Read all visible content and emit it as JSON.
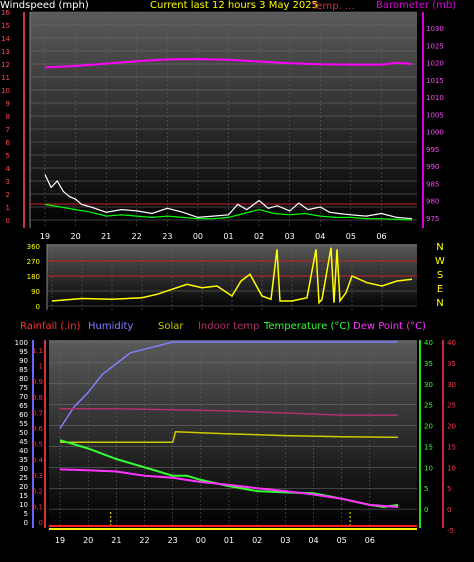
{
  "header": {
    "windspeed_label": "Windspeed (mph)",
    "title": "Current last 12 hours 3 May 2025",
    "temp_label": "Temp. ...",
    "barometer_label": "Barometer (mb)"
  },
  "wind_dir_labels": [
    "N",
    "W",
    "S",
    "E",
    "N"
  ],
  "bottom_header": {
    "rainfall": "Rainfall (.in)",
    "humidity": "Humidity",
    "solar": "Solar",
    "indoor_temp": "Indoor temp",
    "temperature": "Temperature (°C)",
    "dew_point": "Dew Point (°C)"
  },
  "hour_labels": [
    "19",
    "20",
    "21",
    "22",
    "23",
    "00",
    "01",
    "02",
    "03",
    "04",
    "05",
    "06"
  ],
  "colors": {
    "windspeed": "#ffffff",
    "wind_avg": "#00ff00",
    "barometer": "#ff00ff",
    "wind_direction": "#ffff00",
    "rainfall": "#ff3333",
    "humidity": "#8080ff",
    "solar": "#cccc00",
    "indoor_temp": "#b0306a",
    "temperature": "#33ff33",
    "dew_point": "#ff33ff",
    "left_axis_red": "#cc3344",
    "right_axis_magenta": "#dd00dd",
    "right_axis_green": "#22dd22",
    "right_axis_red": "#cc2244"
  },
  "chart_data": [
    {
      "id": "wind-barometer",
      "type": "line",
      "x_hours": [
        0,
        12
      ],
      "x_ticks": [
        "19",
        "20",
        "21",
        "22",
        "23",
        "00",
        "01",
        "02",
        "03",
        "04",
        "05",
        "06"
      ],
      "ylabel_left": "Windspeed (mph)",
      "ylabel_right": "Barometer (mb)",
      "ylim_left": [
        0,
        16
      ],
      "yticks_left": [
        0,
        1,
        2,
        3,
        4,
        5,
        6,
        7,
        8,
        9,
        10,
        11,
        12,
        13,
        14,
        15,
        16
      ],
      "ylim_right": [
        975,
        1030
      ],
      "yticks_right": [
        975,
        980,
        985,
        990,
        995,
        1000,
        1005,
        1010,
        1015,
        1020,
        1025,
        1030
      ],
      "series": [
        {
          "key": "barometer",
          "axis": "right",
          "x": [
            0,
            1,
            2,
            3,
            4,
            5,
            6,
            7,
            8,
            9,
            10,
            11,
            11.5,
            12
          ],
          "values": [
            1018.6,
            1019.0,
            1019.7,
            1020.4,
            1020.9,
            1021.0,
            1020.8,
            1020.3,
            1019.8,
            1019.5,
            1019.4,
            1019.4,
            1019.9,
            1019.6
          ]
        },
        {
          "key": "windspeed",
          "axis": "left",
          "x": [
            0,
            0.2,
            0.4,
            0.6,
            0.8,
            1.0,
            1.2,
            1.5,
            2.0,
            2.5,
            3.0,
            3.5,
            4.0,
            4.5,
            5.0,
            5.5,
            6.0,
            6.3,
            6.6,
            7.0,
            7.3,
            7.6,
            8.0,
            8.3,
            8.6,
            9.0,
            9.3,
            9.6,
            10.0,
            10.5,
            11.0,
            11.5,
            12.0
          ],
          "values": [
            3.5,
            2.5,
            3.0,
            2.2,
            1.8,
            1.6,
            1.2,
            1.0,
            0.6,
            0.8,
            0.7,
            0.5,
            0.9,
            0.6,
            0.2,
            0.3,
            0.4,
            1.2,
            0.8,
            1.5,
            0.9,
            1.1,
            0.7,
            1.3,
            0.8,
            1.0,
            0.6,
            0.5,
            0.4,
            0.3,
            0.5,
            0.2,
            0.1
          ]
        },
        {
          "key": "wind_avg",
          "axis": "left",
          "x": [
            0,
            0.5,
            1.0,
            1.5,
            2.0,
            2.5,
            3.0,
            3.5,
            4.0,
            4.5,
            5.0,
            5.5,
            6.0,
            6.5,
            7.0,
            7.5,
            8.0,
            8.5,
            9.0,
            9.5,
            10.0,
            10.5,
            11.0,
            12.0
          ],
          "values": [
            1.2,
            1.0,
            0.8,
            0.6,
            0.3,
            0.4,
            0.3,
            0.2,
            0.3,
            0.2,
            0.1,
            0.1,
            0.2,
            0.5,
            0.8,
            0.5,
            0.4,
            0.5,
            0.3,
            0.2,
            0.2,
            0.1,
            0.1,
            0.0
          ]
        }
      ]
    },
    {
      "id": "wind-direction",
      "type": "line",
      "x_hours": [
        0,
        12
      ],
      "ylim": [
        0,
        360
      ],
      "yticks": [
        0,
        90,
        180,
        270,
        360
      ],
      "ref_lines": [
        180,
        270
      ],
      "series": [
        {
          "key": "wind_direction",
          "x": [
            0,
            1,
            2,
            3,
            3.5,
            4,
            4.5,
            5,
            5.5,
            6,
            6.3,
            6.6,
            7,
            7.3,
            7.5,
            7.6,
            8,
            8.5,
            8.8,
            8.9,
            9.0,
            9.3,
            9.4,
            9.5,
            9.6,
            9.8,
            10,
            10.5,
            11,
            11.5,
            12
          ],
          "values": [
            30,
            45,
            40,
            50,
            70,
            100,
            130,
            110,
            120,
            60,
            150,
            190,
            60,
            40,
            340,
            30,
            30,
            50,
            340,
            20,
            40,
            350,
            20,
            340,
            30,
            80,
            180,
            140,
            120,
            150,
            160
          ]
        }
      ]
    },
    {
      "id": "temp-humidity",
      "type": "line",
      "x_hours": [
        0,
        12
      ],
      "axes": {
        "rainfall": {
          "ylim": [
            0,
            1.15
          ],
          "yticks": [
            0,
            0.1,
            0.2,
            0.3,
            0.4,
            0.5,
            0.6,
            0.7,
            0.8,
            0.9,
            1.0,
            1.1
          ]
        },
        "humidity": {
          "ylim": [
            0,
            100
          ],
          "yticks": [
            0,
            5,
            10,
            15,
            20,
            25,
            30,
            35,
            40,
            45,
            50,
            55,
            60,
            65,
            70,
            75,
            80,
            85,
            90,
            95,
            100
          ]
        },
        "temperature": {
          "ylim": [
            -5,
            40
          ],
          "yticks": [
            0,
            5,
            10,
            15,
            20,
            25,
            30,
            35,
            40
          ]
        },
        "indoor": {
          "ylim": [
            -5,
            40
          ],
          "yticks": [
            -5,
            0,
            5,
            10,
            15,
            20,
            25,
            30,
            35,
            40
          ]
        }
      },
      "series": [
        {
          "key": "humidity",
          "axis": "humidity",
          "x": [
            0,
            0.5,
            1,
            1.5,
            2,
            2.5,
            3,
            3.5,
            4,
            12
          ],
          "values": [
            52,
            64,
            72,
            82,
            88,
            94,
            96,
            98,
            100,
            100
          ]
        },
        {
          "key": "indoor_temp",
          "axis": "indoor",
          "x": [
            0,
            2,
            4,
            6,
            8,
            10,
            12
          ],
          "values": [
            24,
            24,
            23.8,
            23.5,
            23.0,
            22.5,
            22.5
          ]
        },
        {
          "key": "solar",
          "axis": "temperature",
          "x": [
            0,
            4,
            4.1,
            6,
            8,
            10,
            12
          ],
          "values": [
            16,
            16,
            18.5,
            18,
            17.6,
            17.3,
            17.2
          ]
        },
        {
          "key": "temperature",
          "axis": "temperature",
          "x": [
            0,
            1,
            2,
            3,
            4,
            4.5,
            5,
            6,
            7,
            8,
            9,
            10,
            11,
            11.5,
            12
          ],
          "values": [
            16.5,
            14.5,
            12,
            10,
            8,
            8,
            7,
            5.5,
            4.3,
            4.0,
            3.8,
            2.5,
            1.0,
            0.5,
            1.0
          ]
        },
        {
          "key": "dew_point",
          "axis": "temperature",
          "x": [
            0,
            1,
            2,
            3,
            4,
            5,
            6,
            7,
            8,
            9,
            10,
            11,
            12
          ],
          "values": [
            9.5,
            9.3,
            9,
            8,
            7.5,
            6.5,
            5.8,
            5.0,
            4.3,
            3.5,
            2.5,
            1.0,
            0.5
          ]
        }
      ],
      "rain_marks_hours": [
        1.8,
        10.3
      ]
    }
  ]
}
